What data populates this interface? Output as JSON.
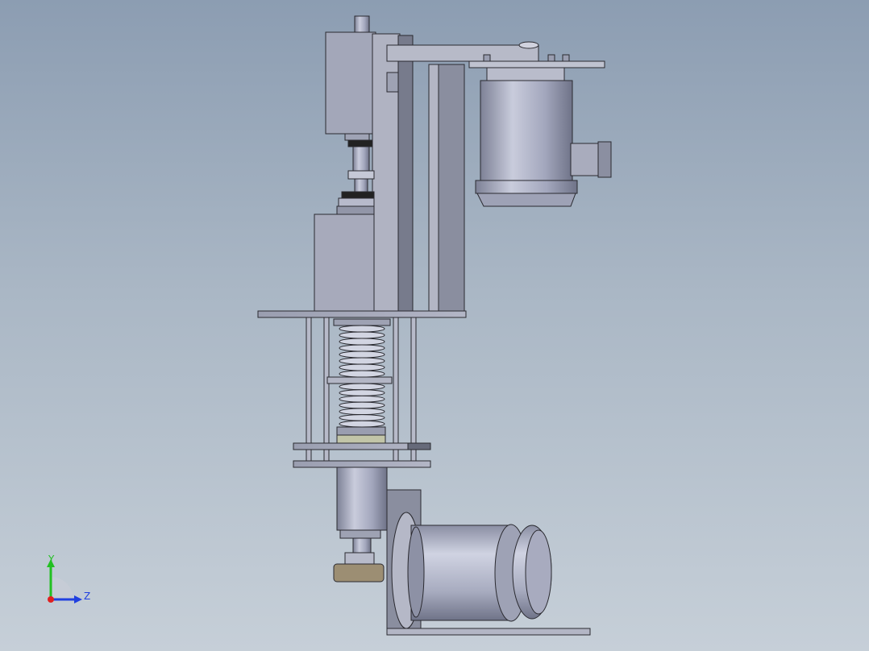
{
  "viewport": {
    "background_top": "#8c9db2",
    "background_bottom": "#c6cfd8"
  },
  "model": {
    "body_color": "#a4a8bc",
    "dark_color": "#6e7283",
    "line_color": "#2a2a30"
  },
  "triad": {
    "y_label": "Y",
    "z_label": "Z",
    "y_color": "#22c022",
    "z_color": "#2040e0",
    "x_color": "#e02020"
  }
}
